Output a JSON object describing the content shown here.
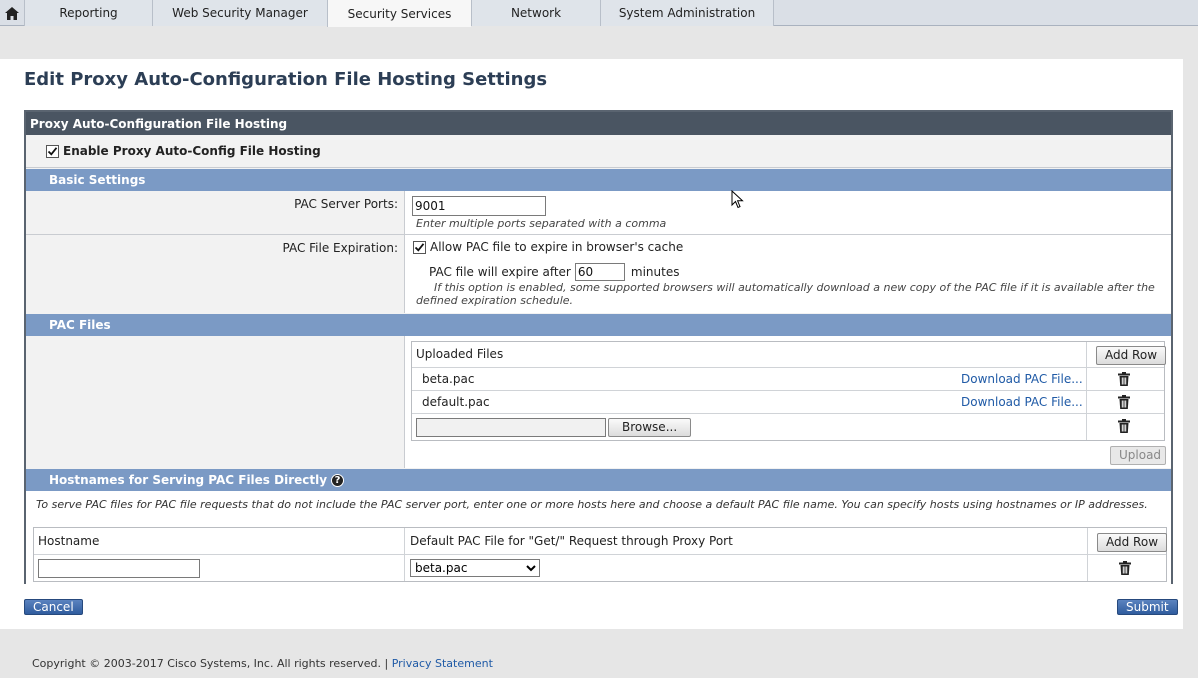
{
  "nav": {
    "tabs": [
      {
        "label": "Reporting"
      },
      {
        "label": "Web Security Manager"
      },
      {
        "label": "Security Services"
      },
      {
        "label": "Network"
      },
      {
        "label": "System Administration"
      }
    ],
    "home_icon": "home-icon"
  },
  "page": {
    "title": "Edit Proxy Auto-Configuration File Hosting Settings"
  },
  "panel": {
    "title": "Proxy Auto-Configuration File Hosting",
    "enable_label": "Enable Proxy Auto-Config File Hosting",
    "enable_checked": true
  },
  "basic": {
    "section_title": "Basic Settings",
    "ports_label": "PAC Server Ports:",
    "ports_value": "9001",
    "ports_hint": "Enter multiple ports separated with a comma",
    "expiration_label": "PAC File Expiration:",
    "allow_expire_label": "Allow PAC file to expire in browser's cache",
    "allow_expire_checked": true,
    "expire_after_prefix": "PAC file will expire after",
    "expire_after_value": "60",
    "expire_after_suffix": "minutes",
    "expire_hint": "If this option is enabled, some supported browsers will automatically download a new copy of the PAC file if it is available after the defined expiration schedule."
  },
  "pac_files": {
    "section_title": "PAC Files",
    "uploaded_header": "Uploaded Files",
    "add_row_label": "Add Row",
    "files": [
      {
        "name": "beta.pac",
        "download_label": "Download PAC File..."
      },
      {
        "name": "default.pac",
        "download_label": "Download PAC File..."
      }
    ],
    "browse_value": "",
    "browse_label": "Browse...",
    "upload_label": "Upload"
  },
  "hostnames": {
    "section_title": "Hostnames for Serving PAC Files Directly",
    "help_icon": "help-icon",
    "description": "To serve PAC files for PAC file requests that do not include the PAC server port, enter one or more hosts here and choose a default PAC file name. You can specify hosts using hostnames or IP addresses.",
    "col_hostname": "Hostname",
    "col_default": "Default PAC File for \"Get/\" Request through Proxy Port",
    "add_row_label": "Add Row",
    "hostname_value": "",
    "default_selected": "beta.pac"
  },
  "actions": {
    "cancel_label": "Cancel",
    "submit_label": "Submit"
  },
  "footer": {
    "copyright": "Copyright © 2003-2017 Cisco Systems, Inc. All rights reserved. |",
    "privacy_label": "Privacy Statement"
  },
  "colors": {
    "section_blue": "#7b9ac5",
    "panel_header": "#4a5562",
    "link": "#1f5aa6",
    "title": "#2c3e55"
  }
}
